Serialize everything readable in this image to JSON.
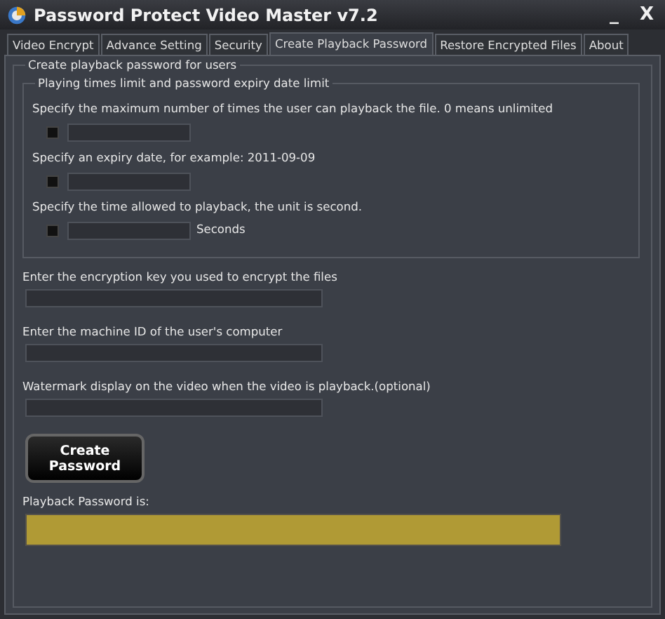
{
  "window": {
    "title": "Password Protect Video Master v7.2",
    "minimize": "_",
    "close": "X"
  },
  "tabs": [
    {
      "label": "Video Encrypt",
      "selected": false
    },
    {
      "label": "Advance Setting",
      "selected": false
    },
    {
      "label": "Security",
      "selected": false
    },
    {
      "label": "Create Playback Password",
      "selected": true
    },
    {
      "label": "Restore Encrypted Files",
      "selected": false
    },
    {
      "label": "About",
      "selected": false
    }
  ],
  "group": {
    "title": "Create playback password for users",
    "limits": {
      "title": "Playing times limit and password expiry date limit",
      "options": [
        {
          "label": "Specify the maximum number of times the user can playback the file. 0 means unlimited",
          "checked": false
        },
        {
          "label": "Specify an expiry date, for example: 2011-09-09",
          "checked": false
        },
        {
          "label": "Specify the time allowed to playback, the unit is second.",
          "checked": false,
          "unit": "Seconds"
        }
      ]
    },
    "fields": [
      {
        "label": "Enter the encryption key you used to encrypt the files"
      },
      {
        "label": "Enter the machine ID of the user's computer"
      },
      {
        "label": "Watermark display on the video when the video is playback.(optional)"
      }
    ],
    "button": "Create Password",
    "result_label": "Playback Password is:"
  }
}
